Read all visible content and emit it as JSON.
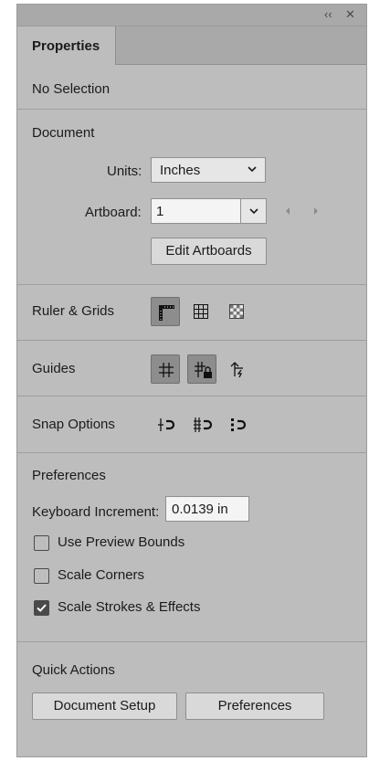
{
  "panel": {
    "controls": {
      "collapse": "‹‹",
      "close": "✕"
    },
    "tab_label": "Properties"
  },
  "selection_status": "No Selection",
  "document": {
    "heading": "Document",
    "units_label": "Units:",
    "units_value": "Inches",
    "artboard_label": "Artboard:",
    "artboard_value": "1",
    "edit_artboards": "Edit Artboards"
  },
  "ruler_grids": {
    "label": "Ruler & Grids",
    "icons": [
      "ruler-icon",
      "grid-icon",
      "transparency-grid-icon"
    ],
    "active": [
      true,
      false,
      false
    ]
  },
  "guides": {
    "label": "Guides",
    "icons": [
      "guides-icon",
      "lock-guides-icon",
      "smart-guides-icon"
    ],
    "active": [
      true,
      true,
      false
    ]
  },
  "snap_options": {
    "label": "Snap Options",
    "icons": [
      "snap-to-point-icon",
      "snap-to-pixel-icon",
      "snap-to-glyph-icon"
    ]
  },
  "preferences": {
    "heading": "Preferences",
    "keyboard_increment_label": "Keyboard Increment:",
    "keyboard_increment_value": "0.0139 in",
    "use_preview_bounds": {
      "label": "Use Preview Bounds",
      "checked": false
    },
    "scale_corners": {
      "label": "Scale Corners",
      "checked": false
    },
    "scale_strokes": {
      "label": "Scale Strokes & Effects",
      "checked": true
    }
  },
  "quick_actions": {
    "heading": "Quick Actions",
    "document_setup": "Document Setup",
    "preferences": "Preferences"
  },
  "colors": {
    "panel_bg": "#bdbdbd",
    "tabstrip_bg": "#a9a9a9",
    "active_icon_bg": "#8d8d8d"
  }
}
